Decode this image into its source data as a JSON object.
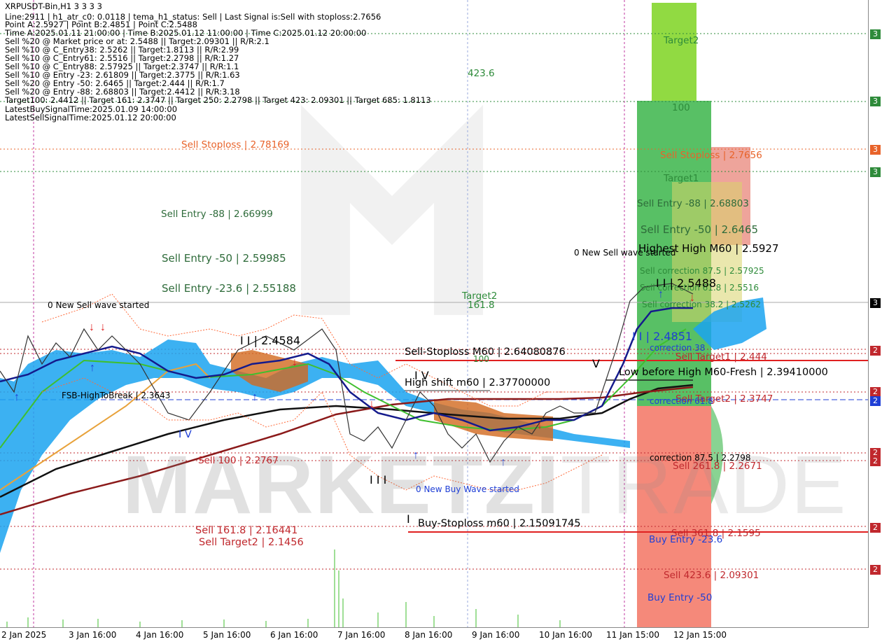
{
  "header": {
    "symbol_line": "XRPUSDT-Bin,H1  3 3 3 3",
    "lines": [
      "Line:2911 | h1_atr_c0: 0.0118 | tema_h1_status: Sell | Last Signal is:Sell with stoploss:2.7656",
      "Point A:2.5927 | Point B:2.4851 | Point C:2.5488",
      "Time A:2025.01.11 21:00:00 | Time B:2025.01.12 11:00:00 | Time C:2025.01.12 20:00:00",
      "Sell %20 @ Market price or at: 2.5488 || Target:2.09301 || R/R:2.1",
      "Sell %10 @ C_Entry38: 2.5262 || Target:1.8113 || R/R:2.99",
      "Sell %10 @ C_Entry61: 2.5516 || Target:2.2798 || R/R:1.27",
      "Sell %10 @ C_Entry88: 2.57925 || Target:2.3747 || R/R:1.1",
      "Sell %10 @ Entry -23: 2.61809 || Target:2.3775 || R/R:1.63",
      "Sell %20 @ Entry -50: 2.6465 || Target:2.444 || R/R:1.7",
      "Sell %20 @ Entry -88: 2.68803 || Target:2.4412 || R/R:3.18",
      "Target100: 2.4412 || Target 161: 2.3747 || Target 250: 2.2798 || Target 423: 2.09301 || Target 685: 1.8113",
      "LatestBuySignalTime:2025.01.09 14:00:00",
      "LatestSellSignalTime:2025.01.12 20:00:00"
    ]
  },
  "left_labels": {
    "sell_stoploss": "Sell Stoploss | 2.78169",
    "sell_entry_88": "Sell Entry -88 | 2.66999",
    "sell_entry_50": "Sell Entry -50 | 2.59985",
    "sell_entry_23": "Sell Entry -23.6 | 2.55188",
    "new_sell_wave": "0 New Sell wave started",
    "fsb": "FSB-HighToBreak | 2.3643",
    "sell_100": "Sell 100 | 2.2767",
    "sell_1618": "Sell 161.8 | 2.16441",
    "sell_target2": "Sell Target2 | 2.1456",
    "wave_iv_left": "I V"
  },
  "mid_labels": {
    "fib_423": "423.6",
    "target2": "Target2",
    "fib_1618": "161.8",
    "fib_100": "100",
    "wave_ii": "I I | 2.4584",
    "wave_iv": "I V",
    "wave_iii": "I I I",
    "wave_i": "I",
    "sell_stoploss_m60": "Sell-Stoploss M60 | 2.64080876",
    "high_shift": "High shift m60 | 2.37700000",
    "buy_stoploss_m60": "Buy-Stoploss m60 | 2.15091745",
    "new_buy_wave": "0 New Buy Wave started",
    "wave_v": "V"
  },
  "right_labels": {
    "target2": "Target2",
    "fib_100": "100",
    "sell_stoploss": "Sell Stoploss | 2.7656",
    "target1": "Target1",
    "sell_entry_88": "Sell Entry -88 | 2.68803",
    "sell_entry_50": "Sell Entry -50 | 2.6465",
    "highest_high": "Highest High   M60 | 2.5927",
    "new_sell_wave": "0 New Sell wave started",
    "sell_corr_875": "Sell correction 87.5 | 2.57925",
    "sell_corr_618": "Sell correction 61.8 | 2.5516",
    "sell_corr_382": "Sell correction 38.2 | 2.5262",
    "point_c": "I I | 2.5488",
    "point_b": "I I | 2.4851",
    "correction_38": "correction 38",
    "sell_target1": "Sell Target1 | 2.444",
    "low_before_high": "Low before High   M60-Fresh | 2.39410000",
    "sell_target2": "Sell Target2 | 2.3747",
    "correction_61": "correction 61.8",
    "sell_250": "correction 87.5 | 2.2798",
    "sell_2618": "Sell  261.8 | 2.2671",
    "sell_3618": "Sell  361.8 | 2.1595",
    "buy_entry_23": "Buy Entry -23.6",
    "sell_4236": "Sell  423.6 | 2.09301",
    "buy_entry_50": "Buy Entry -50"
  },
  "price_tags": [
    {
      "text": "3",
      "color": "#2e8b3a"
    },
    {
      "text": "3",
      "color": "#2e8b3a"
    },
    {
      "text": "3",
      "color": "#e8632a"
    },
    {
      "text": "3",
      "color": "#2e8b3a"
    },
    {
      "text": "3",
      "color": "#000000"
    },
    {
      "text": "2",
      "color": "#c0282d"
    },
    {
      "text": "2",
      "color": "#c0282d"
    },
    {
      "text": "2",
      "color": "#1f3fd6"
    },
    {
      "text": "2",
      "color": "#c0282d"
    },
    {
      "text": "2",
      "color": "#c0282d"
    },
    {
      "text": "2",
      "color": "#c0282d"
    },
    {
      "text": "2",
      "color": "#c0282d"
    }
  ],
  "time_axis": [
    "2 Jan 2025",
    "3 Jan 16:00",
    "4 Jan 16:00",
    "5 Jan 16:00",
    "6 Jan 16:00",
    "7 Jan 16:00",
    "8 Jan 16:00",
    "9 Jan 16:00",
    "10 Jan 16:00",
    "11 Jan 15:00",
    "12 Jan 15:00"
  ],
  "watermark": {
    "bold": "MARKETZI",
    "light": "TRADE"
  },
  "colors": {
    "sell": "#c0282d",
    "buy": "#1f3fd6",
    "green_zone": "#3bb54a",
    "red_zone": "#f47c6b",
    "cloud": "#1aa3f0",
    "orange": "#d2691e"
  }
}
